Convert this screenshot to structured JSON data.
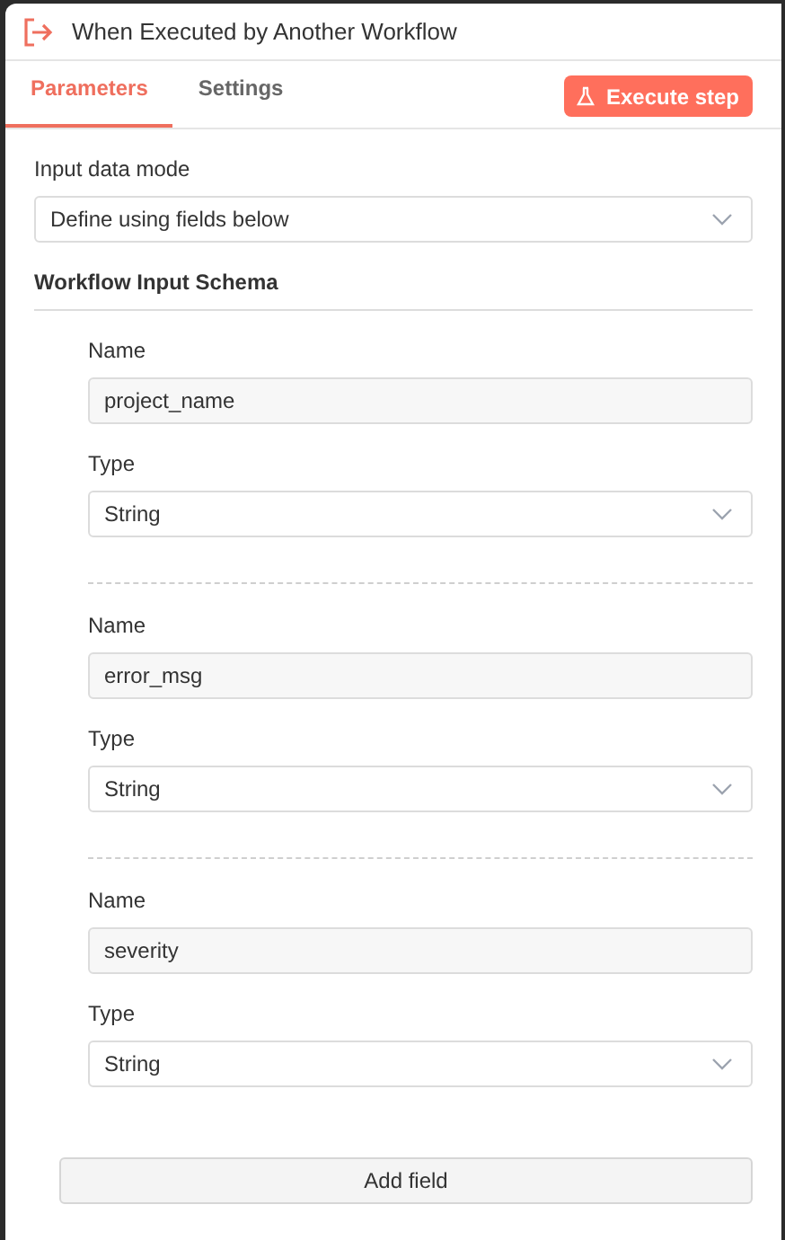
{
  "window": {
    "title": "When Executed by Another Workflow"
  },
  "tabs": [
    {
      "label": "Parameters",
      "selected": true
    },
    {
      "label": "Settings",
      "selected": false
    }
  ],
  "execute_button": {
    "label": "Execute step"
  },
  "input_data_mode": {
    "label": "Input data mode",
    "value": "Define using fields below"
  },
  "schema": {
    "title": "Workflow Input Schema",
    "fields": [
      {
        "name_label": "Name",
        "name_value": "project_name",
        "type_label": "Type",
        "type_value": "String"
      },
      {
        "name_label": "Name",
        "name_value": "error_msg",
        "type_label": "Type",
        "type_value": "String"
      },
      {
        "name_label": "Name",
        "name_value": "severity",
        "type_label": "Type",
        "type_value": "String"
      }
    ],
    "add_button": "Add field"
  }
}
